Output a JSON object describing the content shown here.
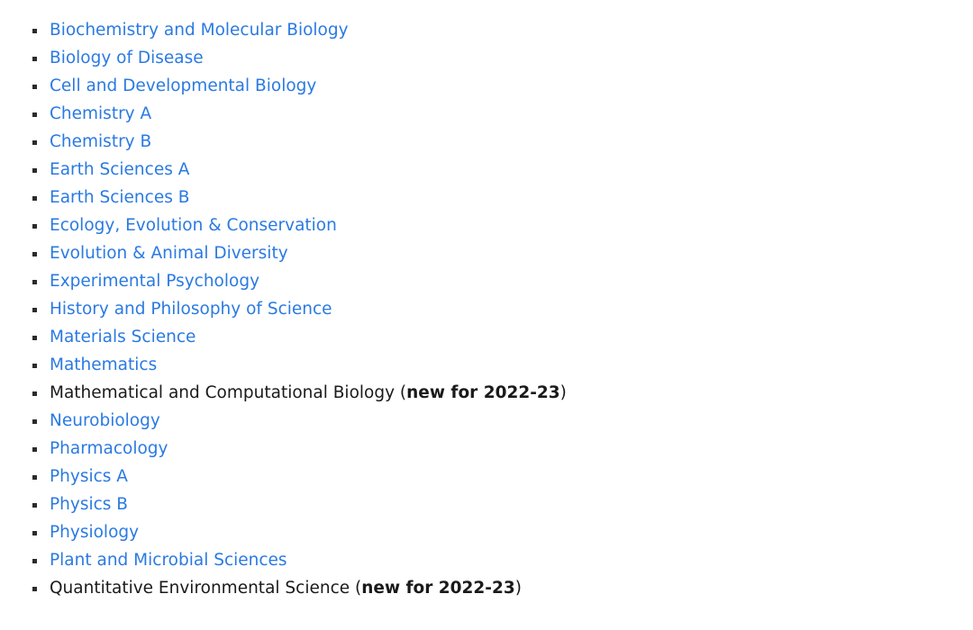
{
  "list": {
    "bullet_color": "#2b2b2b",
    "link_color": "#2a7ae2",
    "text_color": "#1a1a1a",
    "items": [
      {
        "label": "Biochemistry and Molecular Biology",
        "is_link": true
      },
      {
        "label": "Biology of Disease",
        "is_link": true
      },
      {
        "label": "Cell and Developmental Biology",
        "is_link": true
      },
      {
        "label": "Chemistry A",
        "is_link": true
      },
      {
        "label": "Chemistry B",
        "is_link": true
      },
      {
        "label": "Earth Sciences A",
        "is_link": true
      },
      {
        "label": "Earth Sciences B",
        "is_link": true
      },
      {
        "label": "Ecology, Evolution & Conservation",
        "is_link": true
      },
      {
        "label": "Evolution & Animal Diversity",
        "is_link": true
      },
      {
        "label": "Experimental Psychology",
        "is_link": true
      },
      {
        "label": "History and Philosophy of Science",
        "is_link": true
      },
      {
        "label": "Materials Science",
        "is_link": true
      },
      {
        "label": "Mathematics",
        "is_link": true
      },
      {
        "label": "Mathematical and Computational Biology",
        "is_link": false,
        "prefix": "Mathematical and Computational Biology (",
        "tag": "new for 2022-23",
        "suffix": ")"
      },
      {
        "label": "Neurobiology",
        "is_link": true
      },
      {
        "label": "Pharmacology",
        "is_link": true
      },
      {
        "label": "Physics A",
        "is_link": true
      },
      {
        "label": "Physics B",
        "is_link": true
      },
      {
        "label": "Physiology",
        "is_link": true
      },
      {
        "label": "Plant and Microbial Sciences",
        "is_link": true
      },
      {
        "label": "Quantitative Environmental Science",
        "is_link": false,
        "prefix": "Quantitative Environmental Science (",
        "tag": "new for 2022-23",
        "suffix": ")"
      }
    ]
  }
}
